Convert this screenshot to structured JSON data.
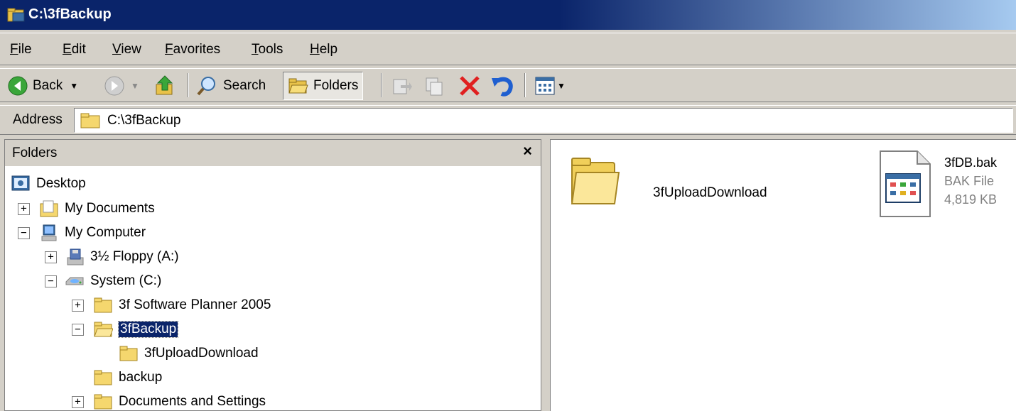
{
  "window": {
    "title": "C:\\3fBackup"
  },
  "menu": [
    "File",
    "Edit",
    "View",
    "Favorites",
    "Tools",
    "Help"
  ],
  "toolbar": {
    "back_label": "Back",
    "search_label": "Search",
    "folders_label": "Folders",
    "icons": [
      "back-arrow-icon",
      "forward-arrow-icon",
      "up-folder-icon",
      "search-icon",
      "folders-icon",
      "move-to-icon",
      "copy-to-icon",
      "delete-icon",
      "undo-icon",
      "views-icon"
    ]
  },
  "address": {
    "label": "Address",
    "value": "C:\\3fBackup"
  },
  "folders_pane": {
    "title": "Folders",
    "close": "×",
    "tree": [
      {
        "label": "Desktop"
      },
      {
        "label": "My Documents",
        "expander": "+"
      },
      {
        "label": "My Computer",
        "expander": "−"
      },
      {
        "label": "3½ Floppy (A:)",
        "expander": "+"
      },
      {
        "label": "System (C:)",
        "expander": "−"
      },
      {
        "label": "3f Software Planner 2005",
        "expander": "+"
      },
      {
        "label": "3fBackup",
        "expander": "−",
        "selected": true
      },
      {
        "label": "3fUploadDownload"
      },
      {
        "label": "backup"
      },
      {
        "label": "Documents and Settings",
        "expander": "+"
      }
    ]
  },
  "contents": {
    "folder_item": {
      "name": "3fUploadDownload"
    },
    "file_item": {
      "name": "3fDB.bak",
      "type": "BAK File",
      "size": "4,819 KB"
    }
  },
  "colors": {
    "titlebar": "#0a246a",
    "chrome": "#d4d0c8",
    "selection": "#0a246a",
    "folder": "#f5d76e"
  }
}
